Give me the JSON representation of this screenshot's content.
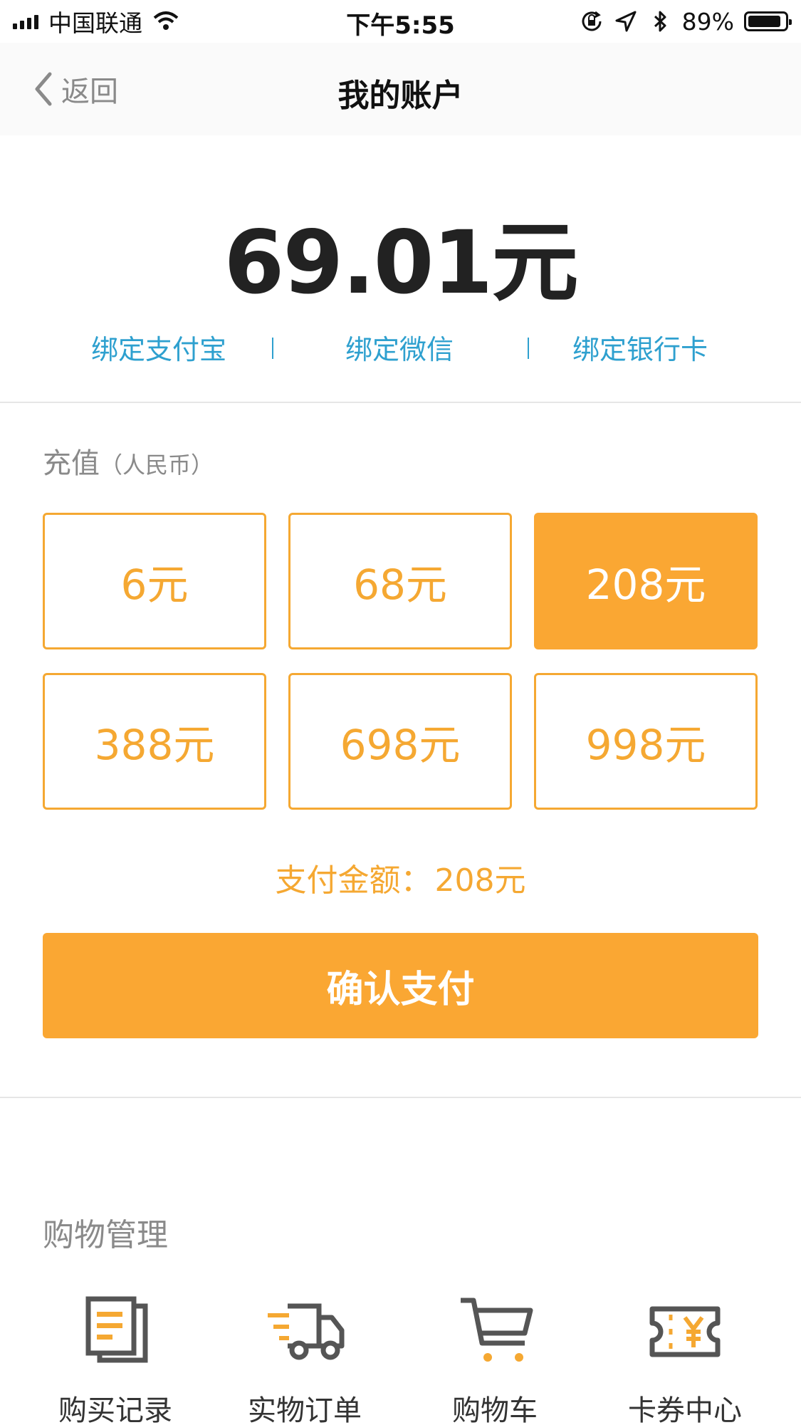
{
  "status_bar": {
    "carrier": "中国联通",
    "time": "下午5:55",
    "battery_percent": "89%",
    "battery_level": 0.89,
    "icons": [
      "signal-icon",
      "wifi-icon",
      "orientation-lock-icon",
      "location-icon",
      "bluetooth-icon",
      "battery-icon"
    ]
  },
  "nav": {
    "back_label": "返回",
    "title": "我的账户"
  },
  "account": {
    "balance": "69.01元",
    "bind_links": [
      "绑定支付宝",
      "绑定微信",
      "绑定银行卡"
    ]
  },
  "recharge": {
    "label": "充值",
    "currency": "（人民币）",
    "options": [
      "6元",
      "68元",
      "208元",
      "388元",
      "698元",
      "998元"
    ],
    "selected": "208元",
    "pay_amount_label": "支付金额：",
    "pay_amount_value": "208元",
    "confirm_label": "确认支付"
  },
  "shopping": {
    "title": "购物管理",
    "items": [
      {
        "label": "购买记录",
        "icon": "purchase-records-icon"
      },
      {
        "label": "实物订单",
        "icon": "delivery-truck-icon"
      },
      {
        "label": "购物车",
        "icon": "shopping-cart-icon"
      },
      {
        "label": "卡券中心",
        "icon": "coupon-ticket-icon"
      }
    ]
  },
  "colors": {
    "accent": "#faa733",
    "link": "#2ea0cf",
    "muted_text": "#8a8a8a"
  }
}
